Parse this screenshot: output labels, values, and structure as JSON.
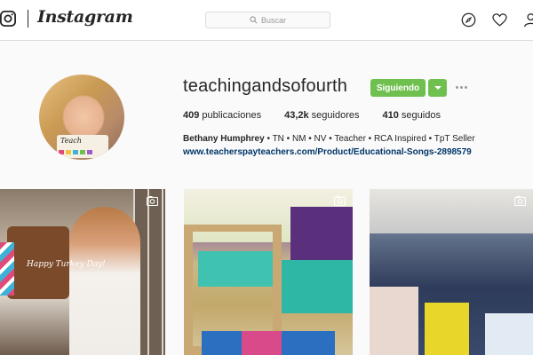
{
  "header": {
    "wordmark": "Instagram",
    "search_placeholder": "Buscar"
  },
  "profile": {
    "username": "teachingandsofourth",
    "follow_label": "Siguiendo",
    "stats": {
      "posts_count": "409",
      "posts_label": "publicaciones",
      "followers_count": "43,2k",
      "followers_label": "seguidores",
      "following_count": "410",
      "following_label": "seguidos"
    },
    "bio_name": "Bethany Humphrey",
    "bio_text": " • TN • NM • NV • Teacher • RCA Inspired • TpT Seller ",
    "website": "www.teacherspayteachers.com/Product/Educational-Songs-2898579",
    "avatar_sign_text": "Teach"
  },
  "posts": [
    {
      "caption_text": "Happy Turkey Day!",
      "type": "video"
    },
    {
      "type": "video"
    },
    {
      "type": "video"
    }
  ],
  "colors": {
    "follow_button": "#70c050",
    "link": "#003569",
    "border": "#dbdbdb",
    "background": "#fafafa"
  },
  "icons": {
    "logo": "instagram-camera-icon",
    "search": "search-icon",
    "explore": "compass-icon",
    "activity": "heart-icon",
    "profile": "person-icon",
    "more": "more-icon",
    "video": "video-icon"
  }
}
